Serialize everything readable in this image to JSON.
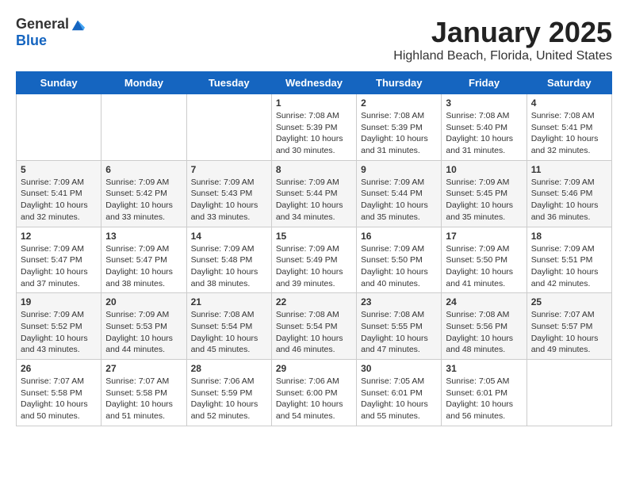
{
  "header": {
    "logo": {
      "general": "General",
      "blue": "Blue"
    },
    "title": "January 2025",
    "subtitle": "Highland Beach, Florida, United States"
  },
  "calendar": {
    "days_of_week": [
      "Sunday",
      "Monday",
      "Tuesday",
      "Wednesday",
      "Thursday",
      "Friday",
      "Saturday"
    ],
    "weeks": [
      [
        {
          "day": "",
          "info": ""
        },
        {
          "day": "",
          "info": ""
        },
        {
          "day": "",
          "info": ""
        },
        {
          "day": "1",
          "info": "Sunrise: 7:08 AM\nSunset: 5:39 PM\nDaylight: 10 hours and 30 minutes."
        },
        {
          "day": "2",
          "info": "Sunrise: 7:08 AM\nSunset: 5:39 PM\nDaylight: 10 hours and 31 minutes."
        },
        {
          "day": "3",
          "info": "Sunrise: 7:08 AM\nSunset: 5:40 PM\nDaylight: 10 hours and 31 minutes."
        },
        {
          "day": "4",
          "info": "Sunrise: 7:08 AM\nSunset: 5:41 PM\nDaylight: 10 hours and 32 minutes."
        }
      ],
      [
        {
          "day": "5",
          "info": "Sunrise: 7:09 AM\nSunset: 5:41 PM\nDaylight: 10 hours and 32 minutes."
        },
        {
          "day": "6",
          "info": "Sunrise: 7:09 AM\nSunset: 5:42 PM\nDaylight: 10 hours and 33 minutes."
        },
        {
          "day": "7",
          "info": "Sunrise: 7:09 AM\nSunset: 5:43 PM\nDaylight: 10 hours and 33 minutes."
        },
        {
          "day": "8",
          "info": "Sunrise: 7:09 AM\nSunset: 5:44 PM\nDaylight: 10 hours and 34 minutes."
        },
        {
          "day": "9",
          "info": "Sunrise: 7:09 AM\nSunset: 5:44 PM\nDaylight: 10 hours and 35 minutes."
        },
        {
          "day": "10",
          "info": "Sunrise: 7:09 AM\nSunset: 5:45 PM\nDaylight: 10 hours and 35 minutes."
        },
        {
          "day": "11",
          "info": "Sunrise: 7:09 AM\nSunset: 5:46 PM\nDaylight: 10 hours and 36 minutes."
        }
      ],
      [
        {
          "day": "12",
          "info": "Sunrise: 7:09 AM\nSunset: 5:47 PM\nDaylight: 10 hours and 37 minutes."
        },
        {
          "day": "13",
          "info": "Sunrise: 7:09 AM\nSunset: 5:47 PM\nDaylight: 10 hours and 38 minutes."
        },
        {
          "day": "14",
          "info": "Sunrise: 7:09 AM\nSunset: 5:48 PM\nDaylight: 10 hours and 38 minutes."
        },
        {
          "day": "15",
          "info": "Sunrise: 7:09 AM\nSunset: 5:49 PM\nDaylight: 10 hours and 39 minutes."
        },
        {
          "day": "16",
          "info": "Sunrise: 7:09 AM\nSunset: 5:50 PM\nDaylight: 10 hours and 40 minutes."
        },
        {
          "day": "17",
          "info": "Sunrise: 7:09 AM\nSunset: 5:50 PM\nDaylight: 10 hours and 41 minutes."
        },
        {
          "day": "18",
          "info": "Sunrise: 7:09 AM\nSunset: 5:51 PM\nDaylight: 10 hours and 42 minutes."
        }
      ],
      [
        {
          "day": "19",
          "info": "Sunrise: 7:09 AM\nSunset: 5:52 PM\nDaylight: 10 hours and 43 minutes."
        },
        {
          "day": "20",
          "info": "Sunrise: 7:09 AM\nSunset: 5:53 PM\nDaylight: 10 hours and 44 minutes."
        },
        {
          "day": "21",
          "info": "Sunrise: 7:08 AM\nSunset: 5:54 PM\nDaylight: 10 hours and 45 minutes."
        },
        {
          "day": "22",
          "info": "Sunrise: 7:08 AM\nSunset: 5:54 PM\nDaylight: 10 hours and 46 minutes."
        },
        {
          "day": "23",
          "info": "Sunrise: 7:08 AM\nSunset: 5:55 PM\nDaylight: 10 hours and 47 minutes."
        },
        {
          "day": "24",
          "info": "Sunrise: 7:08 AM\nSunset: 5:56 PM\nDaylight: 10 hours and 48 minutes."
        },
        {
          "day": "25",
          "info": "Sunrise: 7:07 AM\nSunset: 5:57 PM\nDaylight: 10 hours and 49 minutes."
        }
      ],
      [
        {
          "day": "26",
          "info": "Sunrise: 7:07 AM\nSunset: 5:58 PM\nDaylight: 10 hours and 50 minutes."
        },
        {
          "day": "27",
          "info": "Sunrise: 7:07 AM\nSunset: 5:58 PM\nDaylight: 10 hours and 51 minutes."
        },
        {
          "day": "28",
          "info": "Sunrise: 7:06 AM\nSunset: 5:59 PM\nDaylight: 10 hours and 52 minutes."
        },
        {
          "day": "29",
          "info": "Sunrise: 7:06 AM\nSunset: 6:00 PM\nDaylight: 10 hours and 54 minutes."
        },
        {
          "day": "30",
          "info": "Sunrise: 7:05 AM\nSunset: 6:01 PM\nDaylight: 10 hours and 55 minutes."
        },
        {
          "day": "31",
          "info": "Sunrise: 7:05 AM\nSunset: 6:01 PM\nDaylight: 10 hours and 56 minutes."
        },
        {
          "day": "",
          "info": ""
        }
      ]
    ]
  }
}
